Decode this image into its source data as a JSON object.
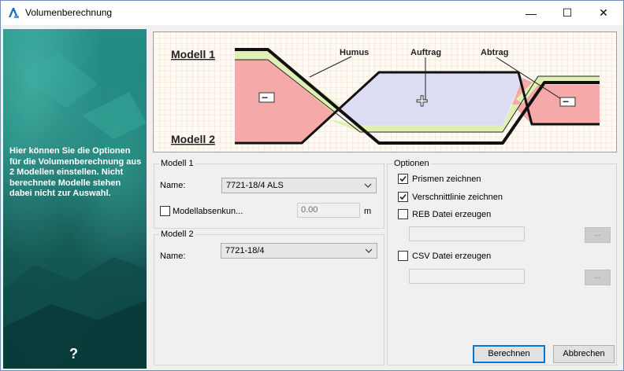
{
  "window": {
    "title": "Volumenberechnung",
    "minimize_glyph": "—",
    "maximize_glyph": "☐",
    "close_glyph": "✕"
  },
  "left_panel": {
    "text": "Hier können Sie die Optionen für die Volumenberechnung aus 2 Modellen einstellen. Nicht berechnete Modelle stehen dabei nicht zur Auswahl.",
    "help_glyph": "?"
  },
  "diagram": {
    "model1_label": "Modell 1",
    "model2_label": "Modell 2",
    "humus_label": "Humus",
    "auftrag_label": "Auftrag",
    "abtrag_label": "Abtrag",
    "minus_symbol": "−",
    "plus_symbol": "+",
    "colors": {
      "abtrag_fill": "#f5a9a9",
      "auftrag_fill": "#dcdcf5",
      "humus_fill": "#e0efb3",
      "grid": "#f3d9c2"
    }
  },
  "modell1": {
    "group_title": "Modell 1",
    "name_label": "Name:",
    "name_value": "7721-18/4 ALS",
    "offset_label": "Modellabsenkun...",
    "offset_checked": false,
    "offset_value": "0.00",
    "unit": "m"
  },
  "modell2": {
    "group_title": "Modell 2",
    "name_label": "Name:",
    "name_value": "7721-18/4"
  },
  "optionen": {
    "group_title": "Optionen",
    "prismen_label": "Prismen zeichnen",
    "prismen_checked": true,
    "verschnitt_label": "Verschnittlinie zeichnen",
    "verschnitt_checked": true,
    "reb_label": "REB Datei erzeugen",
    "reb_checked": false,
    "csv_label": "CSV Datei erzeugen",
    "csv_checked": false,
    "browse_label": "..."
  },
  "buttons": {
    "berechnen": "Berechnen",
    "abbrechen": "Abbrechen"
  }
}
